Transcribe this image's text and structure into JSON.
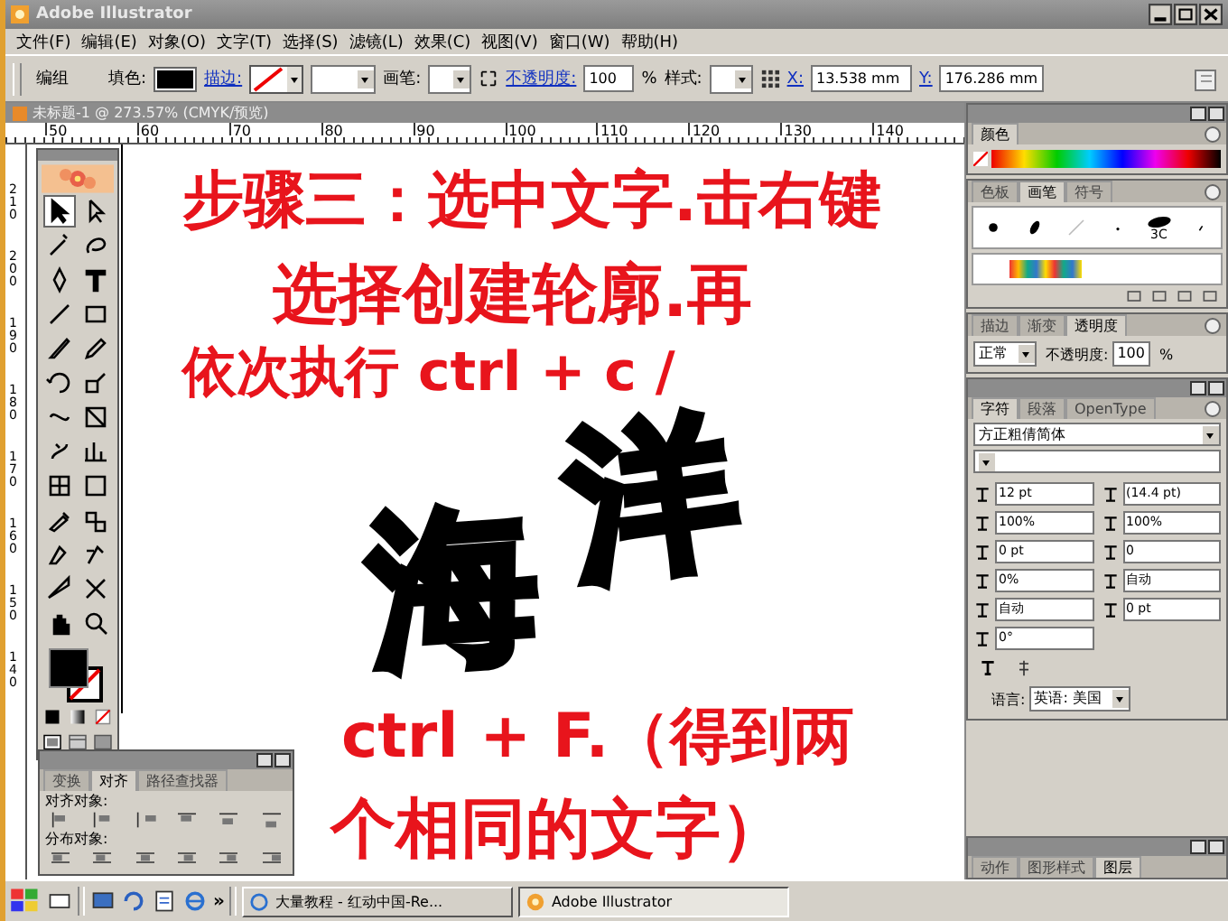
{
  "window": {
    "title": "Adobe Illustrator"
  },
  "menu": [
    "文件(F)",
    "编辑(E)",
    "对象(O)",
    "文字(T)",
    "选择(S)",
    "滤镜(L)",
    "效果(C)",
    "视图(V)",
    "窗口(W)",
    "帮助(H)"
  ],
  "control_bar": {
    "selection": "编组",
    "fill_label": "填色:",
    "stroke_label": "描边:",
    "brush_label": "画笔:",
    "opacity_label": "不透明度:",
    "opacity": "100",
    "percent": "%",
    "style_label": "样式:",
    "x_label": "X:",
    "x": "13.538 mm",
    "y_label": "Y:",
    "y": "176.286 mm"
  },
  "document": {
    "tab": "未标题-1 @ 273.57% (CMYK/预览)",
    "ruler_h": [
      "50",
      "60",
      "70",
      "80",
      "90",
      "100",
      "110",
      "120",
      "130",
      "140"
    ],
    "ruler_v": [
      "210",
      "200",
      "190",
      "180",
      "170",
      "160",
      "150",
      "140"
    ]
  },
  "annotation": [
    "步骤三：选中文字.击右键",
    "选择创建轮廓.再",
    "依次执行 ctrl + c /",
    "ctrl + F.（得到两",
    "个相同的文字）"
  ],
  "artwork": [
    {
      "char": "海"
    },
    {
      "char": "洋"
    }
  ],
  "color_panel": {
    "tabs": [
      {
        "label": "颜色",
        "selected": true
      }
    ]
  },
  "brush_panel": {
    "tabs": [
      {
        "label": "色板",
        "selected": false
      },
      {
        "label": "画笔",
        "selected": true
      },
      {
        "label": "符号",
        "selected": false
      }
    ],
    "brush_size": "3C"
  },
  "transparency_panel": {
    "tabs": [
      {
        "label": "描边",
        "selected": false
      },
      {
        "label": "渐变",
        "selected": false
      },
      {
        "label": "透明度",
        "selected": true
      }
    ],
    "blend": "正常",
    "opacity_label": "不透明度:",
    "opacity": "100",
    "percent": "%"
  },
  "character_panel": {
    "tabs": [
      {
        "label": "字符",
        "selected": true
      },
      {
        "label": "段落",
        "selected": false
      },
      {
        "label": "OpenType",
        "selected": false
      }
    ],
    "font": "方正粗倩简体",
    "fields": [
      {
        "value": "12 pt"
      },
      {
        "value": "(14.4 pt)"
      },
      {
        "value": "100%"
      },
      {
        "value": "100%"
      },
      {
        "value": "0 pt"
      },
      {
        "value": "0"
      },
      {
        "value": "0%"
      },
      {
        "value": "自动"
      },
      {
        "value": "自动"
      },
      {
        "value": "0 pt"
      },
      {
        "value": "0°"
      }
    ],
    "language_label": "语言:",
    "language": "英语: 美国"
  },
  "align_panel": {
    "tabs": [
      {
        "label": "变换",
        "selected": false
      },
      {
        "label": "对齐",
        "selected": true
      },
      {
        "label": "路径查找器",
        "selected": false
      }
    ],
    "align_label": "对齐对象:",
    "distribute_label": "分布对象:"
  },
  "layers_panel": {
    "tabs": [
      {
        "label": "动作",
        "selected": false
      },
      {
        "label": "图形样式",
        "selected": false
      },
      {
        "label": "图层",
        "selected": true
      }
    ]
  },
  "taskbar": {
    "overflow": "»",
    "tasks": [
      {
        "label": "大量教程 - 红动中国-Re...",
        "selected": false
      },
      {
        "label": "Adobe Illustrator",
        "selected": true
      }
    ]
  }
}
